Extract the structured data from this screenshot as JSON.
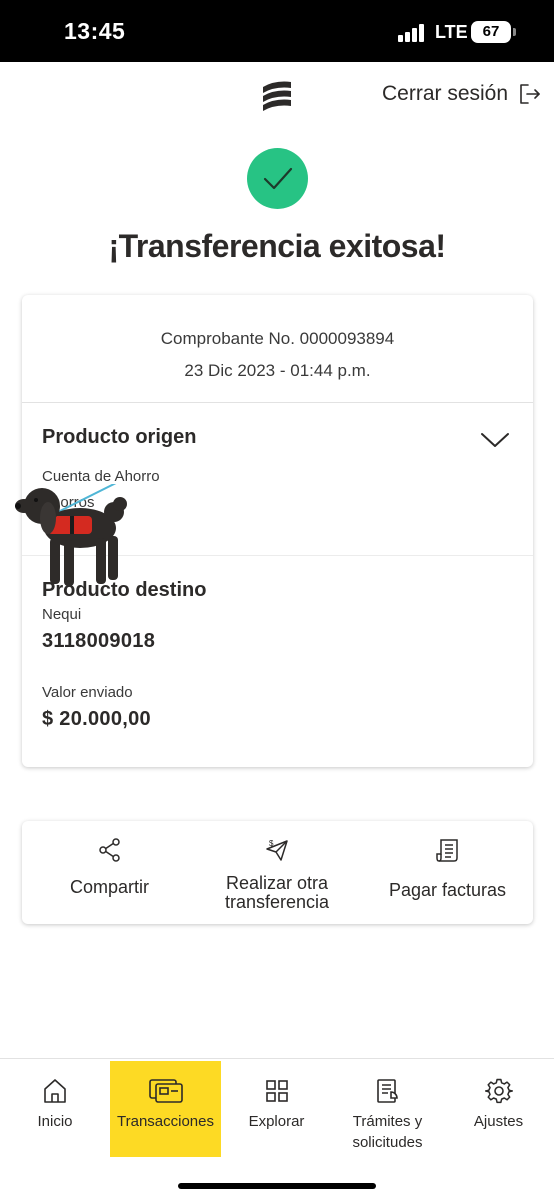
{
  "status_bar": {
    "time": "13:45",
    "network": "LTE",
    "battery": "67"
  },
  "header": {
    "logout_label": "Cerrar sesión"
  },
  "success": {
    "title": "¡Transferencia exitosa!",
    "check_color": "#27c384"
  },
  "receipt": {
    "number": "Comprobante No. 0000093894",
    "date": "23 Dic 2023 - 01:44 p.m."
  },
  "origin": {
    "title": "Producto origen",
    "account_type": "Cuenta de Ahorro",
    "account_sub": "Ahorros"
  },
  "destination": {
    "title": "Producto destino",
    "bank": "Nequi",
    "account": "3118009018"
  },
  "amount": {
    "label": "Valor enviado",
    "value": "$ 20.000,00"
  },
  "actions": [
    {
      "label": "Compartir",
      "icon": "share-icon"
    },
    {
      "label_line1": "Realizar otra",
      "label_line2": "transferencia",
      "icon": "send-money-icon"
    },
    {
      "label": "Pagar facturas",
      "icon": "bill-icon"
    }
  ],
  "nav": [
    {
      "label": "Inicio",
      "icon": "home-icon"
    },
    {
      "label": "Transacciones",
      "icon": "transactions-icon",
      "active": true
    },
    {
      "label": "Explorar",
      "icon": "grid-icon"
    },
    {
      "label_line1": "Trámites y",
      "label_line2": "solicitudes",
      "icon": "documents-icon"
    },
    {
      "label": "Ajustes",
      "icon": "gear-icon"
    }
  ],
  "colors": {
    "accent": "#fdda24",
    "text": "#2c2a29",
    "success": "#27c384"
  }
}
